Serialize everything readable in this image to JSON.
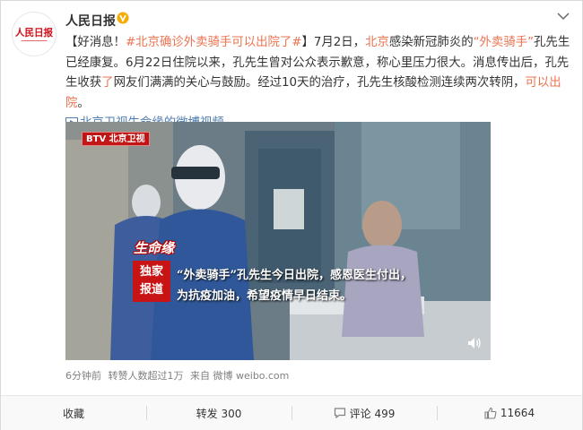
{
  "account": {
    "name": "人民日报",
    "avatar_text": "人民日报"
  },
  "post": {
    "p1": "【好消息！",
    "topic": "#北京确诊外卖骑手可以出院了#",
    "p2": "】7月2日，",
    "loc": "北京",
    "p3": "感染新冠肺炎的",
    "quote": "“外卖骑手”",
    "p4": "孔先生已经康复。6月22日住院以来，孔先生曾对公众表示歉意，称心里压力很大。消息传出后，孔先生收获",
    "hl": "了",
    "p5": "网友们满满的关心与鼓励。经过10天的治疗，孔先生核酸检测连续两次转阴，",
    "end": "可以出院",
    "p6": "。",
    "video_link": "北京卫视生命缘的微博视频"
  },
  "video": {
    "logo": "BTV 北京卫视",
    "program": "生命缘",
    "exclusive": [
      "独家",
      "报道"
    ],
    "subtitle_1": "“外卖骑手”孔先生今日出院，感恩医生付出，",
    "subtitle_2": "为抗疫加油，希望疫情早日结束。"
  },
  "meta": {
    "time": "6分钟前",
    "reposts_note": "转赞人数超过1万",
    "source": "来自 微博 weibo.com"
  },
  "actions": {
    "collect": "收藏",
    "repost": "转发 300",
    "comment": "评论 499",
    "like": "11664"
  },
  "colors": {
    "link": "#eb7350",
    "video_link": "#507daf",
    "verified": "#f6ab00"
  }
}
